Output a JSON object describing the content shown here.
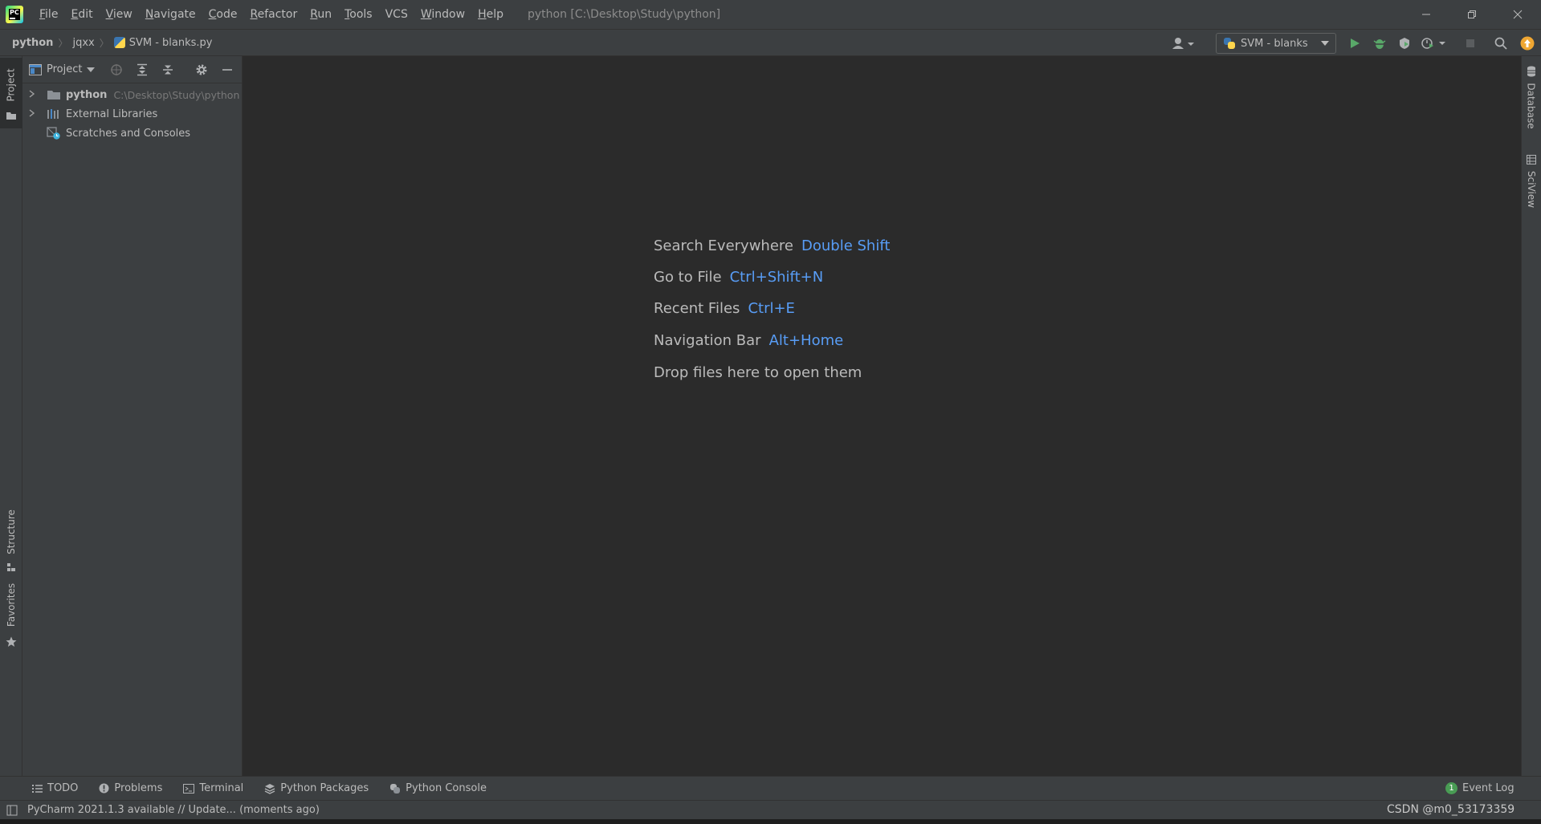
{
  "titlebar": {
    "menu": [
      {
        "label": "File",
        "mn": "F",
        "rest": "ile"
      },
      {
        "label": "Edit",
        "mn": "E",
        "rest": "dit"
      },
      {
        "label": "View",
        "mn": "V",
        "rest": "iew"
      },
      {
        "label": "Navigate",
        "mn": "N",
        "rest": "avigate"
      },
      {
        "label": "Code",
        "mn": "C",
        "rest": "ode"
      },
      {
        "label": "Refactor",
        "mn": "R",
        "rest": "efactor"
      },
      {
        "label": "Run",
        "mn": "R",
        "rest": "un"
      },
      {
        "label": "Tools",
        "mn": "T",
        "rest": "ools"
      },
      {
        "label": "VCS",
        "mn": "",
        "rest": "VCS"
      },
      {
        "label": "Window",
        "mn": "W",
        "rest": "indow"
      },
      {
        "label": "Help",
        "mn": "H",
        "rest": "elp"
      }
    ],
    "window_title": "python [C:\\Desktop\\Study\\python]",
    "logo_text": "PC"
  },
  "navbar": {
    "breadcrumbs": [
      "python",
      "jqxx",
      "SVM - blanks.py"
    ],
    "run_config": "SVM - blanks"
  },
  "left_strip": {
    "top": "Project",
    "structure": "Structure",
    "favorites": "Favorites"
  },
  "right_strip": {
    "database": "Database",
    "sciview": "SciView"
  },
  "project_panel": {
    "title": "Project",
    "tree": [
      {
        "label": "python",
        "path": "C:\\Desktop\\Study\\python"
      },
      {
        "label": "External Libraries"
      },
      {
        "label": "Scratches and Consoles"
      }
    ]
  },
  "editor": {
    "hints": [
      {
        "text": "Search Everywhere",
        "key": "Double Shift"
      },
      {
        "text": "Go to File",
        "key": "Ctrl+Shift+N"
      },
      {
        "text": "Recent Files",
        "key": "Ctrl+E"
      },
      {
        "text": "Navigation Bar",
        "key": "Alt+Home"
      },
      {
        "text": "Drop files here to open them",
        "key": ""
      }
    ]
  },
  "bottom_tabs": [
    {
      "label": "TODO",
      "icon": "list-icon"
    },
    {
      "label": "Problems",
      "icon": "problems-icon"
    },
    {
      "label": "Terminal",
      "icon": "terminal-icon"
    },
    {
      "label": "Python Packages",
      "icon": "packages-icon"
    },
    {
      "label": "Python Console",
      "icon": "python-icon"
    }
  ],
  "event_log": {
    "label": "Event Log",
    "count": "1"
  },
  "status": {
    "message": "PyCharm 2021.1.3 available // Update... (moments ago)",
    "watermark": "CSDN @m0_53173359"
  },
  "colors": {
    "accent_key": "#589df6",
    "run_green": "#59a869",
    "bg": "#2b2b2b",
    "panel": "#3c3f41"
  }
}
